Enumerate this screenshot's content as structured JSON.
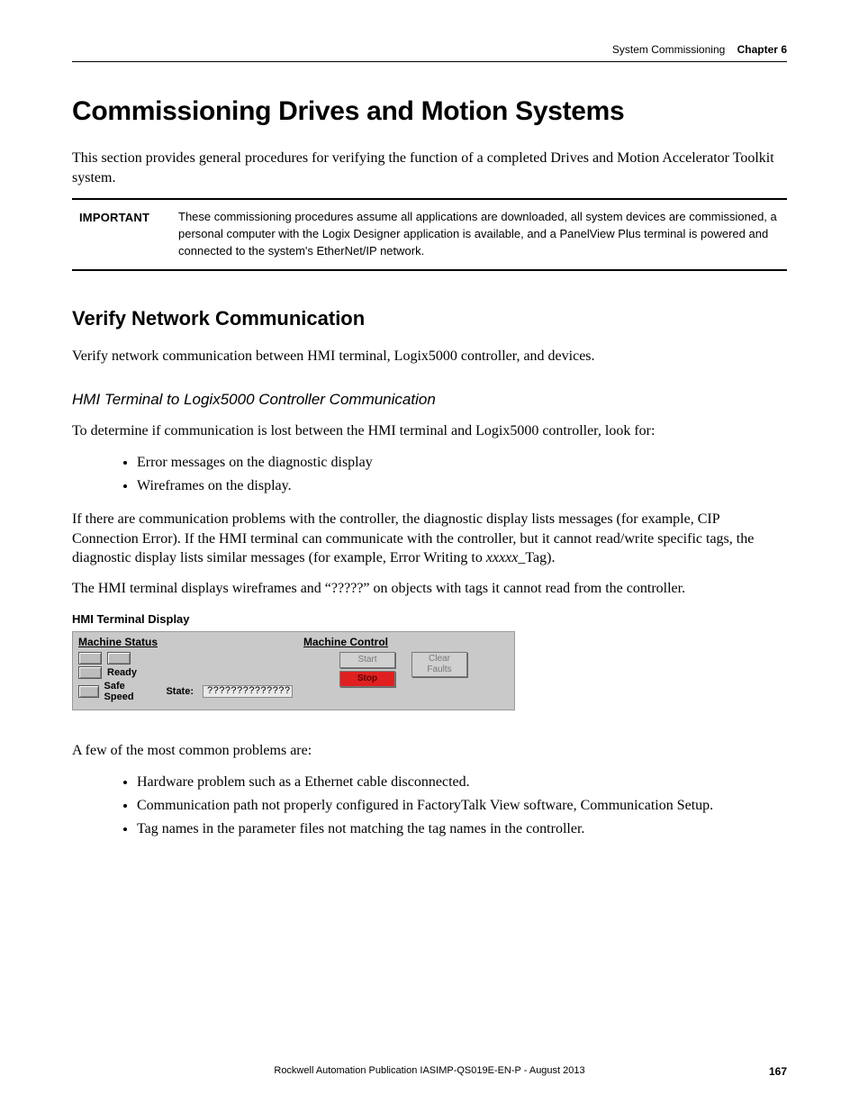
{
  "running_head": {
    "section": "System Commissioning",
    "chapter": "Chapter 6"
  },
  "h1": "Commissioning Drives and Motion Systems",
  "intro_p": "This section provides general procedures for verifying the function of a completed Drives and Motion Accelerator Toolkit system.",
  "important": {
    "label": "IMPORTANT",
    "text": "These commissioning procedures assume all applications are downloaded, all system devices are commissioned, a personal computer with the Logix Designer application is available, and a PanelView Plus terminal is powered and connected to the system's EtherNet/IP network."
  },
  "h2": "Verify Network Communication",
  "verify_p": "Verify network communication between HMI terminal, Logix5000 controller, and devices.",
  "h3": "HMI Terminal to Logix5000 Controller Communication",
  "determine_p": "To determine if communication is lost between the HMI terminal and Logix5000 controller, look for:",
  "look_for": [
    "Error messages on the diagnostic display",
    "Wireframes on the display."
  ],
  "comm_problems_p": "If there are communication problems with the controller, the diagnostic display lists messages (for example, CIP Connection Error). If the HMI terminal can communicate with the controller, but it cannot read/write specific tags, the diagnostic display lists similar messages (for example, Error Writing to ",
  "comm_problems_tag": "xxxxx",
  "comm_problems_tail": "_Tag).",
  "wireframes_p": "The HMI terminal displays wireframes and “?????” on objects with tags it cannot read from the controller.",
  "fig_caption": "HMI Terminal Display",
  "hmi": {
    "status_h": "Machine Status",
    "control_h": "Machine Control",
    "ready": "Ready",
    "safe_speed": "Safe Speed",
    "state_label": "State:",
    "state_value": "??????????????",
    "start": "Start",
    "stop": "Stop",
    "clear_line1": "Clear",
    "clear_line2": "Faults"
  },
  "common_intro": "A few of the most common problems are:",
  "common_problems": [
    "Hardware problem such as a Ethernet cable disconnected.",
    "Communication path not properly configured in FactoryTalk View software, Communication Setup.",
    "Tag names in the parameter files not matching the tag names in the controller."
  ],
  "footer": {
    "pub": "Rockwell Automation Publication IASIMP-QS019E-EN-P - August 2013",
    "page": "167"
  }
}
